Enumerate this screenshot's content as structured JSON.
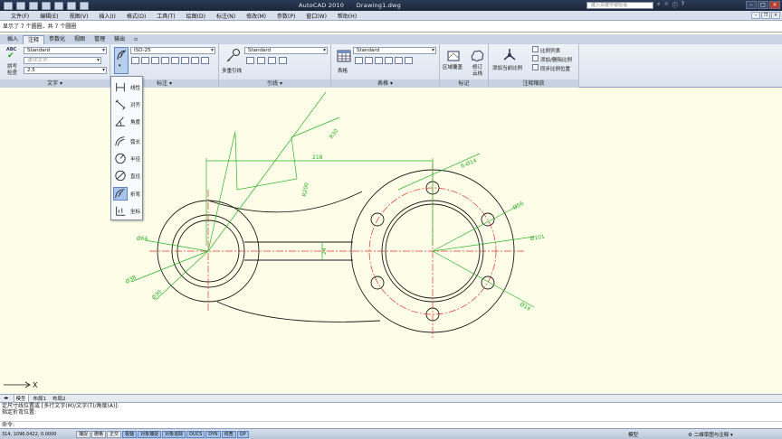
{
  "window": {
    "title": "AutoCAD 2010",
    "document": "Drawing1.dwg",
    "search_placeholder": "键入关键字或短语"
  },
  "menubar": {
    "items": [
      "文件(F)",
      "编辑(E)",
      "视图(V)",
      "插入(I)",
      "格式(O)",
      "工具(T)",
      "绘图(D)",
      "标注(N)",
      "修改(M)",
      "参数(P)",
      "窗口(W)",
      "帮助(H)"
    ]
  },
  "top_command": "显示了 7 个圆圈，共 7 个圆圈",
  "ribbon": {
    "tabs": [
      {
        "label": "插入",
        "active": false
      },
      {
        "label": "注释",
        "active": true
      },
      {
        "label": "参数化",
        "active": false
      },
      {
        "label": "视图",
        "active": false
      },
      {
        "label": "管理",
        "active": false
      },
      {
        "label": "输出",
        "active": false
      }
    ],
    "text_panel": {
      "title": "文字",
      "spell_label": "ABC",
      "spell_text1": "拼写",
      "spell_text2": "检查",
      "style": "Standard",
      "find_placeholder": "查找文字",
      "height": "2.5"
    },
    "dim_panel": {
      "title": "标注",
      "style": "ISO-25"
    },
    "leader_panel": {
      "title": "引线",
      "style": "Standard",
      "multileader": "多重引线"
    },
    "table_panel": {
      "title": "表格",
      "style": "Standard",
      "table": "表格"
    },
    "markup_panel": {
      "title": "标记",
      "wipeout": "区域覆盖",
      "revcloud1": "修订",
      "revcloud2": "云线"
    },
    "scale_panel": {
      "title": "注释缩放",
      "add_current": "添加当前比例",
      "scale_list": "比例列表",
      "add_delete": "添加/删除比例",
      "sync": "同步比例位置"
    }
  },
  "dim_menu": {
    "items": [
      {
        "label": "线性",
        "icon": "linear-dim-icon"
      },
      {
        "label": "对齐",
        "icon": "aligned-dim-icon"
      },
      {
        "label": "角度",
        "icon": "angular-dim-icon"
      },
      {
        "label": "弧长",
        "icon": "arc-length-icon"
      },
      {
        "label": "半径",
        "icon": "radius-dim-icon"
      },
      {
        "label": "直径",
        "icon": "diameter-dim-icon"
      },
      {
        "label": "折弯",
        "icon": "jogged-dim-icon",
        "selected": true
      },
      {
        "label": "坐标",
        "icon": "ordinate-dim-icon"
      }
    ]
  },
  "drawing": {
    "dims": {
      "length": "218",
      "r_small": "R30",
      "r_mid": "R200",
      "holes": "6-Ø14",
      "d56": "Ø56",
      "d101": "Ø101",
      "d14": "Ø14",
      "d64": "Ø64",
      "d38": "Ø38",
      "d30": "Ø30",
      "d24": "24"
    },
    "axis_label": "X"
  },
  "layout_tabs": [
    "模型",
    "布局1",
    "布局2"
  ],
  "command_history": [
    "定尺寸线位置或 [多行文字(M)/文字(T)/角度(A)]:",
    "指定折弯位置:"
  ],
  "command_prompt": "命令:",
  "statusbar": {
    "coords": "314, 1096.0422, 0.0000",
    "buttons": [
      {
        "label": "捕捉",
        "on": false
      },
      {
        "label": "栅格",
        "on": false
      },
      {
        "label": "正交",
        "on": false
      },
      {
        "label": "极轴",
        "on": true
      },
      {
        "label": "对象捕捉",
        "on": true
      },
      {
        "label": "对象追踪",
        "on": true
      },
      {
        "label": "DUCS",
        "on": true
      },
      {
        "label": "DYN",
        "on": true
      },
      {
        "label": "线宽",
        "on": true
      },
      {
        "label": "QP",
        "on": true
      }
    ],
    "model": "模型",
    "workspace": "二维草图与注释"
  }
}
